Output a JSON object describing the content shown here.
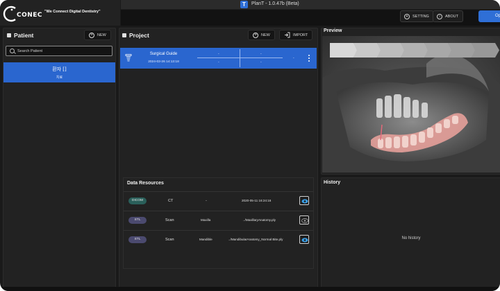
{
  "window": {
    "title": "PlanT - 1.0.47b (Beta)"
  },
  "brand": {
    "logo_text": "CONEC",
    "tagline": "\"We Connect Digital Dentistry\""
  },
  "header": {
    "setting_label": "SETTING",
    "about_label": "ABOUT",
    "primary_label": "Op"
  },
  "patient": {
    "title": "Patient",
    "new_label": "NEW",
    "search_placeholder": "Search Patient",
    "items": [
      {
        "name": "환자 []",
        "sub": "치료"
      }
    ]
  },
  "project": {
    "title": "Project",
    "new_label": "NEW",
    "import_label": "IMPORT",
    "items": [
      {
        "name": "Surgical Guide",
        "date": "2024-03-26 14:13:18",
        "dash": "-"
      }
    ]
  },
  "data_resources": {
    "title": "Data Resources",
    "rows": [
      {
        "type": "DICOM",
        "kind": "CT",
        "jaw": "-",
        "file": "2020-05-11 16:24:16",
        "visible": true
      },
      {
        "type": "STL",
        "kind": "Scan",
        "jaw": "Maxilla",
        "file": "../MaxillaryAnatomy.ply",
        "visible": false
      },
      {
        "type": "STL",
        "kind": "Scan",
        "jaw": "Mandible",
        "file": "../MandibularAnatomy_Normal Bite.ply",
        "visible": true
      }
    ]
  },
  "preview": {
    "title": "Preview"
  },
  "history": {
    "title": "History",
    "empty_text": "No history"
  },
  "colors": {
    "accent": "#2a66cf",
    "eye_active": "#3aa0e8",
    "eye_inactive": "#9a9a9a"
  }
}
